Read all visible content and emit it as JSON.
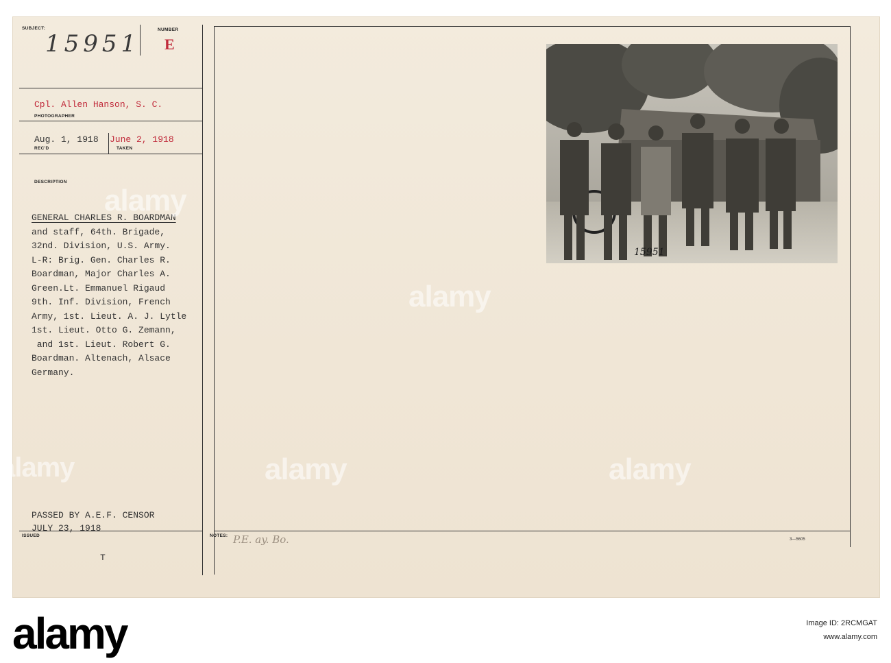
{
  "card": {
    "labels": {
      "subject": "SUBJECT:",
      "number": "NUMBER",
      "photographer": "PHOTOGRAPHER",
      "recd": "REC'D",
      "taken": "TAKEN",
      "description": "DESCRIPTION",
      "issued": "ISSUED",
      "notes": "NOTES:"
    },
    "subject_number": "15951",
    "number_letter": "E",
    "photographer_name": "Cpl. Allen Hanson, S. C.",
    "recd_date": "Aug. 1, 1918",
    "taken_date": "June 2, 1918",
    "description": {
      "title": "GENERAL CHARLES R. BOARDMAN",
      "lines": [
        "and staff, 64th. Brigade,",
        "32nd. Division, U.S. Army.",
        "L-R: Brig. Gen. Charles R.",
        "Boardman, Major Charles A.",
        "Green.Lt. Emmanuel Rigaud",
        "9th. Inf. Division, French",
        "Army, 1st. Lieut. A. J. Lytle",
        "1st. Lieut. Otto G. Zemann,",
        " and 1st. Lieut. Robert G.",
        "Boardman. Altenach, Alsace",
        "Germany."
      ]
    },
    "censor_line1": "PASSED BY A.E.F. CENSOR",
    "censor_line2": "JULY 23, 1918",
    "issued_mark": "T",
    "notes_handwriting": "P.E. ay. Bo.",
    "form_code": "3—5605",
    "photo_number": "15951"
  },
  "watermarks": {
    "brand": "alamy"
  },
  "footer": {
    "logo": "alamy",
    "image_id_label": "Image ID: 2RCMGAT",
    "url": "www.alamy.com"
  }
}
